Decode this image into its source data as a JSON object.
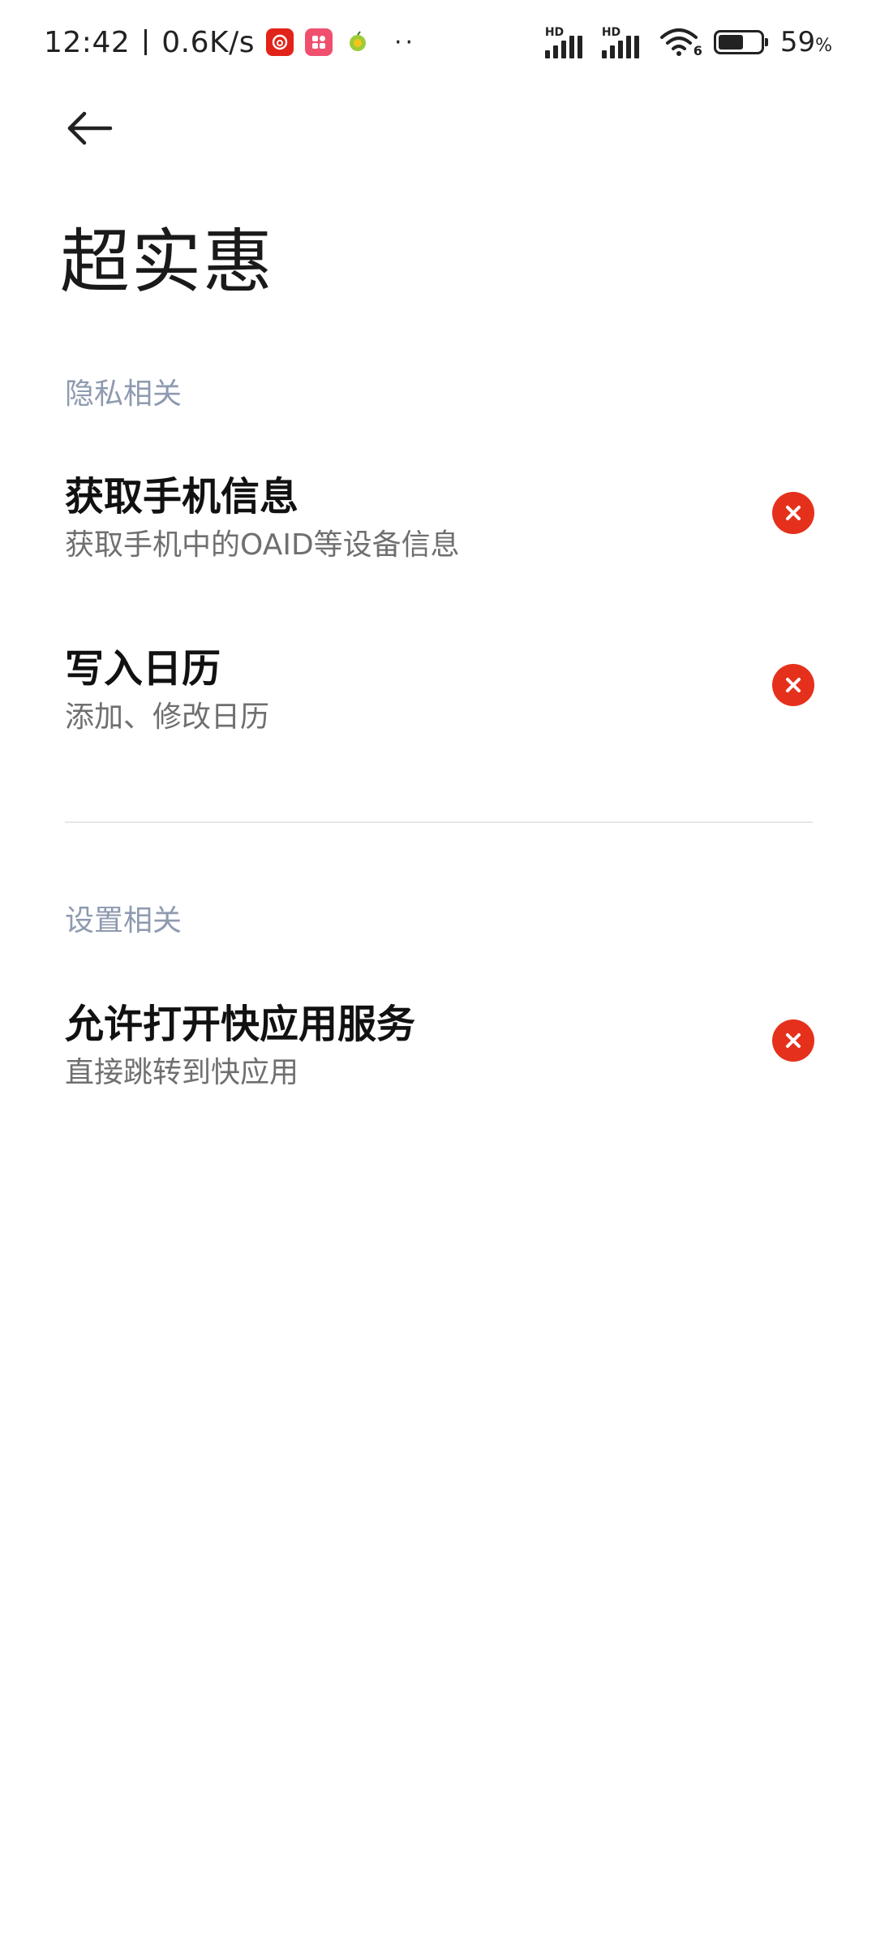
{
  "status_bar": {
    "time": "12:42",
    "network_speed": "0.6K/s",
    "notification_icons": [
      "netease-music-icon",
      "app-store-icon",
      "game-icon"
    ],
    "more_indicator": "··",
    "signal_1_label": "HD",
    "signal_2_label": "HD",
    "wifi_label": "6",
    "battery_level": 0.59,
    "battery_percent": "59",
    "battery_unit": "%"
  },
  "header": {
    "back_icon": "arrow-left-icon",
    "title": "超实惠"
  },
  "sections": [
    {
      "header": "隐私相关",
      "items": [
        {
          "title": "获取手机信息",
          "description": "获取手机中的OAID等设备信息",
          "status_icon": "deny-icon"
        },
        {
          "title": "写入日历",
          "description": "添加、修改日历",
          "status_icon": "deny-icon"
        }
      ]
    },
    {
      "header": "设置相关",
      "items": [
        {
          "title": "允许打开快应用服务",
          "description": "直接跳转到快应用",
          "status_icon": "deny-icon"
        }
      ]
    }
  ],
  "colors": {
    "deny": "#e5311c",
    "section_header": "#8e9aaf",
    "description": "#6f6f6f",
    "divider": "#e6e6e6"
  }
}
